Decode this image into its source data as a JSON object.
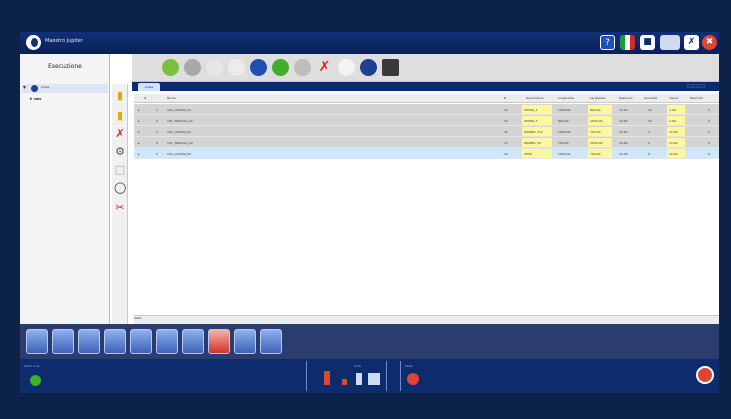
{
  "app": {
    "title": "Maestro Jupiter"
  },
  "titlebar_icons": [
    {
      "name": "help-icon",
      "glyph": "?",
      "color": "#1f4fb5"
    },
    {
      "name": "italian-flag-icon",
      "glyph": "",
      "color": "#ffffff"
    },
    {
      "name": "user-icon",
      "glyph": "↓",
      "color": "#1f4fb5"
    },
    {
      "name": "display-icon",
      "glyph": "",
      "color": "#cfd9ef"
    },
    {
      "name": "tools-icon",
      "glyph": "✕",
      "color": "#1f4fb5"
    },
    {
      "name": "close-icon",
      "glyph": "✖",
      "color": "#e0452f"
    }
  ],
  "sidebar": {
    "title": "Esecuzione",
    "tree": {
      "root": "Linee",
      "child": "MRS"
    }
  },
  "tab": {
    "label": "Linea"
  },
  "grid": {
    "columns": [
      "#",
      "Nome",
      "N",
      "Descrizione",
      "Lunghezza",
      "Larghezza",
      "Spessore",
      "Quantità",
      "Valore",
      "Pezzi tot."
    ],
    "rows": [
      {
        "num": "1",
        "name": "101_LASTRA_01",
        "n": "10",
        "desc": "VETRO_1",
        "len": "1000,00",
        "wid": "800,00",
        "thk": "10,00",
        "qty": "10",
        "val": "1,00",
        "tot": "0",
        "style": "gray"
      },
      {
        "num": "2",
        "name": "101_TRAVALA_01",
        "n": "10",
        "desc": "VETRO_T",
        "len": "800,00",
        "wid": "1000,00",
        "thk": "10,00",
        "qty": "10",
        "val": "1,00",
        "tot": "0",
        "style": "gray"
      },
      {
        "num": "3",
        "name": "101_LASTRA_02",
        "n": "41",
        "desc": "MARMO_T11",
        "len": "1000,00",
        "wid": "700,00",
        "thk": "10,00",
        "qty": "1",
        "val": "10,00",
        "tot": "0",
        "style": "gray"
      },
      {
        "num": "4",
        "name": "101_TRAVALA_02",
        "n": "11",
        "desc": "MARMO_S3",
        "len": "790,00",
        "wid": "1000,00",
        "thk": "10,00",
        "qty": "1",
        "val": "10,00",
        "tot": "0",
        "style": "gray"
      },
      {
        "num": "5",
        "name": "101_LASTRA_03",
        "n": "10",
        "desc": "VETR",
        "len": "1000,00",
        "wid": "700,00",
        "thk": "10,00",
        "qty": "0",
        "val": "10,00",
        "tot": "0",
        "style": "sel"
      }
    ],
    "footer": "Stato"
  },
  "statusbar": {
    "left_label": "Stato ciclo",
    "center_label": "Ciclo",
    "right_label": "Stato"
  },
  "colors": {
    "accent": "#0d2b74",
    "highlight": "#fff79c",
    "selected": "#cfe6fb"
  }
}
